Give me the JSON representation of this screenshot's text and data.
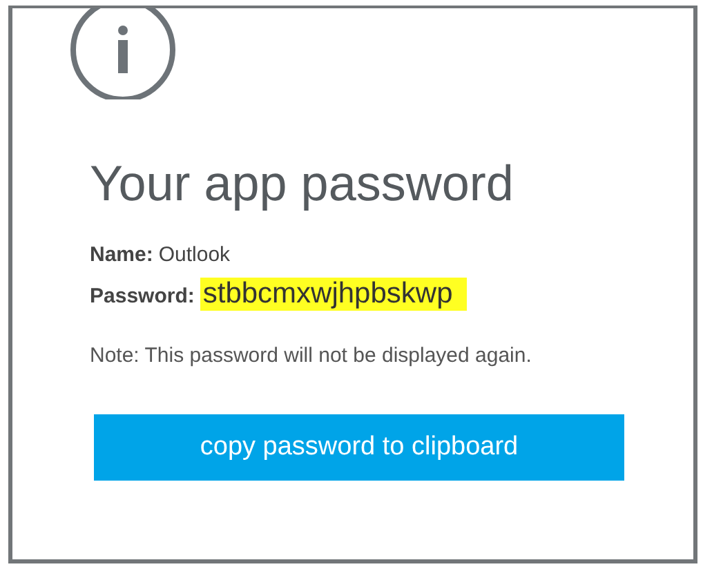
{
  "dialog": {
    "title": "Your app password",
    "name_label": "Name:",
    "name_value": "Outlook",
    "password_label": "Password:",
    "password_value": "stbbcmxwjhpbskwp",
    "note": "Note: This password will not be displayed again.",
    "button": "copy password to clipboard"
  }
}
